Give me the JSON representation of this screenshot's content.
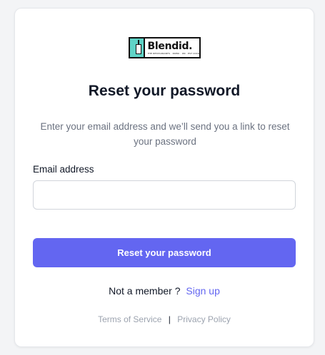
{
  "logo": {
    "word": "Blendid.",
    "tagline": "THE RESTAURANTS · ROBO · ON · EST 2016"
  },
  "title": "Reset your password",
  "subtitle": "Enter your email address and we’ll send you a link to reset your password",
  "form": {
    "email_label": "Email address",
    "email_value": "",
    "email_placeholder": "",
    "submit_label": "Reset your password"
  },
  "signup": {
    "prompt": "Not a member ?",
    "link_label": "Sign up"
  },
  "footer": {
    "terms_label": "Terms of Service",
    "separator": "|",
    "privacy_label": "Privacy Policy"
  },
  "colors": {
    "accent": "#6366f1",
    "logo_teal": "#5fd3c6"
  }
}
